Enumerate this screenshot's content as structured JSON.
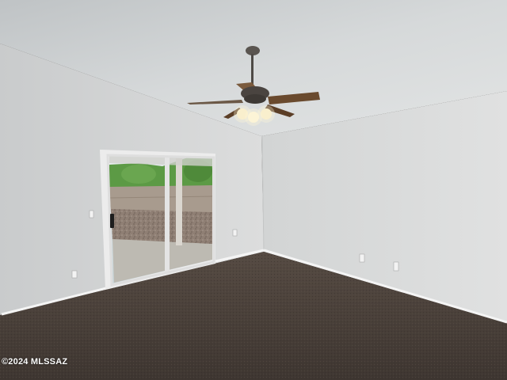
{
  "watermark": {
    "text": "©2024 MLSSAZ"
  },
  "colors": {
    "ceiling": "#d7dadb",
    "left_wall": "#d4d6d7",
    "right_wall": "#dadcdc",
    "carpet": "#4a4039",
    "baseboard": "#f2f2f2",
    "door_frame": "#e8e8e8",
    "fan_blade": "#6a4a2e",
    "fan_metal": "#5a5550",
    "foliage": "#5c9a45",
    "patio": "#b9b6ae"
  }
}
